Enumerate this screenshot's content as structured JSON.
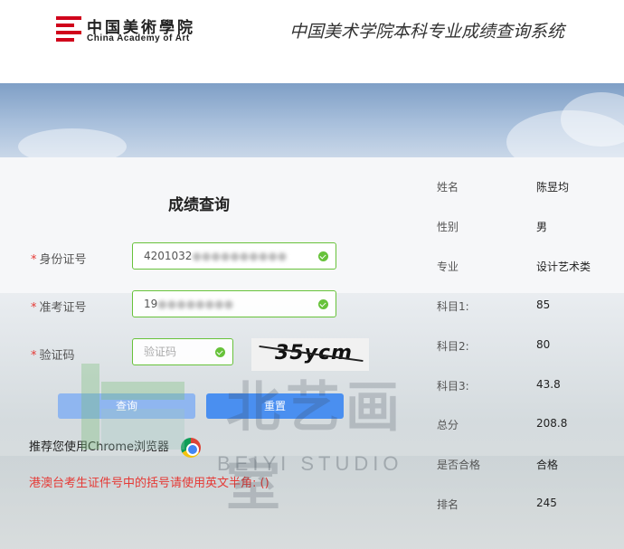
{
  "header": {
    "logo_cn": "中国美術學院",
    "logo_en": "China Academy of Art",
    "system_title": "中国美术学院本科专业成绩查询系统"
  },
  "form": {
    "title": "成绩查询",
    "id_label": "身份证号",
    "id_value": "4201032",
    "exam_label": "准考证号",
    "exam_value": "19",
    "captcha_label": "验证码",
    "captcha_placeholder": "验证码",
    "captcha_text": "35ycm",
    "query_button": "查询",
    "reset_button": "重置",
    "required_mark": "*"
  },
  "tips": {
    "chrome": "推荐您使用Chrome浏览器",
    "hk_note": "港澳台考生证件号中的括号请使用英文半角: ()"
  },
  "result": [
    {
      "label": "姓名",
      "value": "陈昱均"
    },
    {
      "label": "性别",
      "value": "男"
    },
    {
      "label": "专业",
      "value": "设计艺术类"
    },
    {
      "label": "科目1:",
      "value": "85"
    },
    {
      "label": "科目2:",
      "value": "80"
    },
    {
      "label": "科目3:",
      "value": "43.8"
    },
    {
      "label": "总分",
      "value": "208.8"
    },
    {
      "label": "是否合格",
      "value": "合格"
    },
    {
      "label": "排名",
      "value": "245"
    }
  ],
  "watermark": {
    "cn": "北艺画室",
    "en": "BEIYI STUDIO"
  },
  "colors": {
    "accent": "#4a8ff0",
    "valid": "#67c23a",
    "warning": "#e53935",
    "brand": "#d0021b"
  }
}
